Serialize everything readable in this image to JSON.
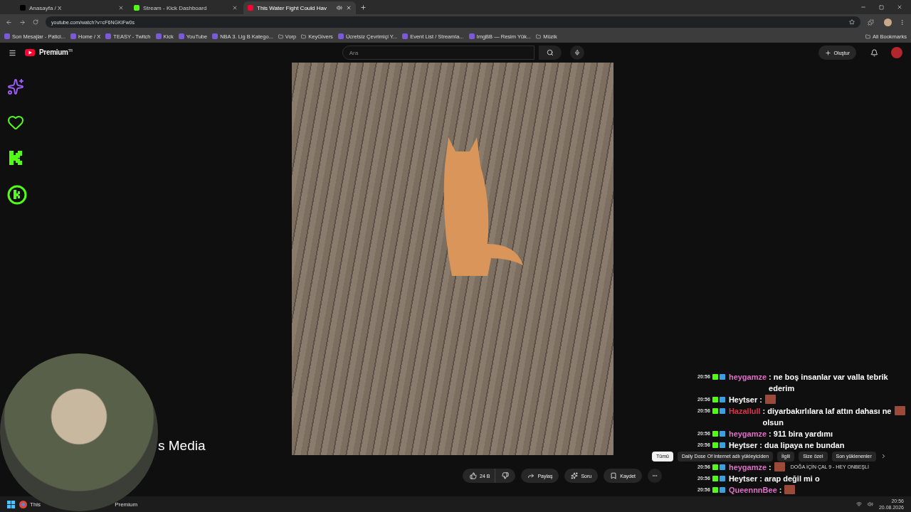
{
  "browser": {
    "tabs": [
      {
        "title": "Anasayfa / X",
        "kind": "x",
        "selected": false,
        "audio": false
      },
      {
        "title": "Stream - Kick Dashboard",
        "kind": "kick",
        "selected": false,
        "audio": false
      },
      {
        "title": "This Water Fight Could Hav",
        "kind": "youtube",
        "selected": true,
        "audio": true
      }
    ],
    "address": "youtube.com/watch?v=cF6NGKiFw0s",
    "bookmarks": [
      {
        "label": "Son Mesajlar - Patici...",
        "kind": "site"
      },
      {
        "label": "Home / X",
        "kind": "site"
      },
      {
        "label": "TEASY - Twitch",
        "kind": "site"
      },
      {
        "label": "Kick",
        "kind": "site"
      },
      {
        "label": "YouTube",
        "kind": "site"
      },
      {
        "label": "NBA 3. Lig B Katego...",
        "kind": "site"
      },
      {
        "label": "Vorp",
        "kind": "folder"
      },
      {
        "label": "KeyGivers",
        "kind": "folder"
      },
      {
        "label": "Ücretsiz Çevrimiçi Y...",
        "kind": "site"
      },
      {
        "label": "Event List / Streamla...",
        "kind": "site"
      },
      {
        "label": "ImgBB — Resim Yük...",
        "kind": "site"
      },
      {
        "label": "Müzik",
        "kind": "folder"
      }
    ],
    "all_bookmarks": "All Bookmarks"
  },
  "header": {
    "logo": "Premium",
    "region": "TR",
    "search_placeholder": "Ara",
    "create": "Oluştur"
  },
  "video": {
    "channel_fragment": "s Media",
    "likes": "24 B",
    "actions": [
      {
        "label": "Paylaş",
        "kind": "share"
      },
      {
        "label": "Soru",
        "kind": "ask"
      },
      {
        "label": "Kaydet",
        "kind": "save"
      }
    ]
  },
  "chips": [
    {
      "label": "Tümü",
      "selected": true
    },
    {
      "label": "Daily Dose Of Internet adlı yükleyiciden",
      "selected": false
    },
    {
      "label": "İlgili",
      "selected": false
    },
    {
      "label": "Size özel",
      "selected": false
    },
    {
      "label": "Son yüklenenler",
      "selected": false
    }
  ],
  "suggested": {
    "title": "DOĞA İÇİN ÇAL 9 - HEY ONBEŞLİ"
  },
  "chat": [
    {
      "time": "20:56",
      "user": "heygamze",
      "color": "#e070c8",
      "text": ": ne boş insanlar var valla tebrik ederim",
      "emote": false
    },
    {
      "time": "20:56",
      "user": "Heytser",
      "color": "#ffffff",
      "text": ":",
      "emote": true
    },
    {
      "time": "20:56",
      "user": "Hazallull",
      "color": "#d8364a",
      "text": ": diyarbakırlılara laf attın dahası ne olsun",
      "emote": true
    },
    {
      "time": "20:56",
      "user": "heygamze",
      "color": "#e070c8",
      "text": ": 911 bira yardımı",
      "emote": false
    },
    {
      "time": "20:56",
      "user": "Heytser",
      "color": "#ffffff",
      "text": ": dua lipaya ne bundan",
      "emote": false
    },
    {
      "time": "20:56",
      "user": "heygamze",
      "color": "#e070c8",
      "text": ":",
      "emote": true
    },
    {
      "time": "20:56",
      "user": "Heytser",
      "color": "#ffffff",
      "text": ": arap değil mi o",
      "emote": false
    },
    {
      "time": "20:56",
      "user": "QueennnBee",
      "color": "#e070c8",
      "text": ":",
      "emote": true
    }
  ],
  "taskbar": {
    "apps": [
      "This",
      "Premium"
    ],
    "time": "20:56",
    "date": "20.08.2026"
  }
}
